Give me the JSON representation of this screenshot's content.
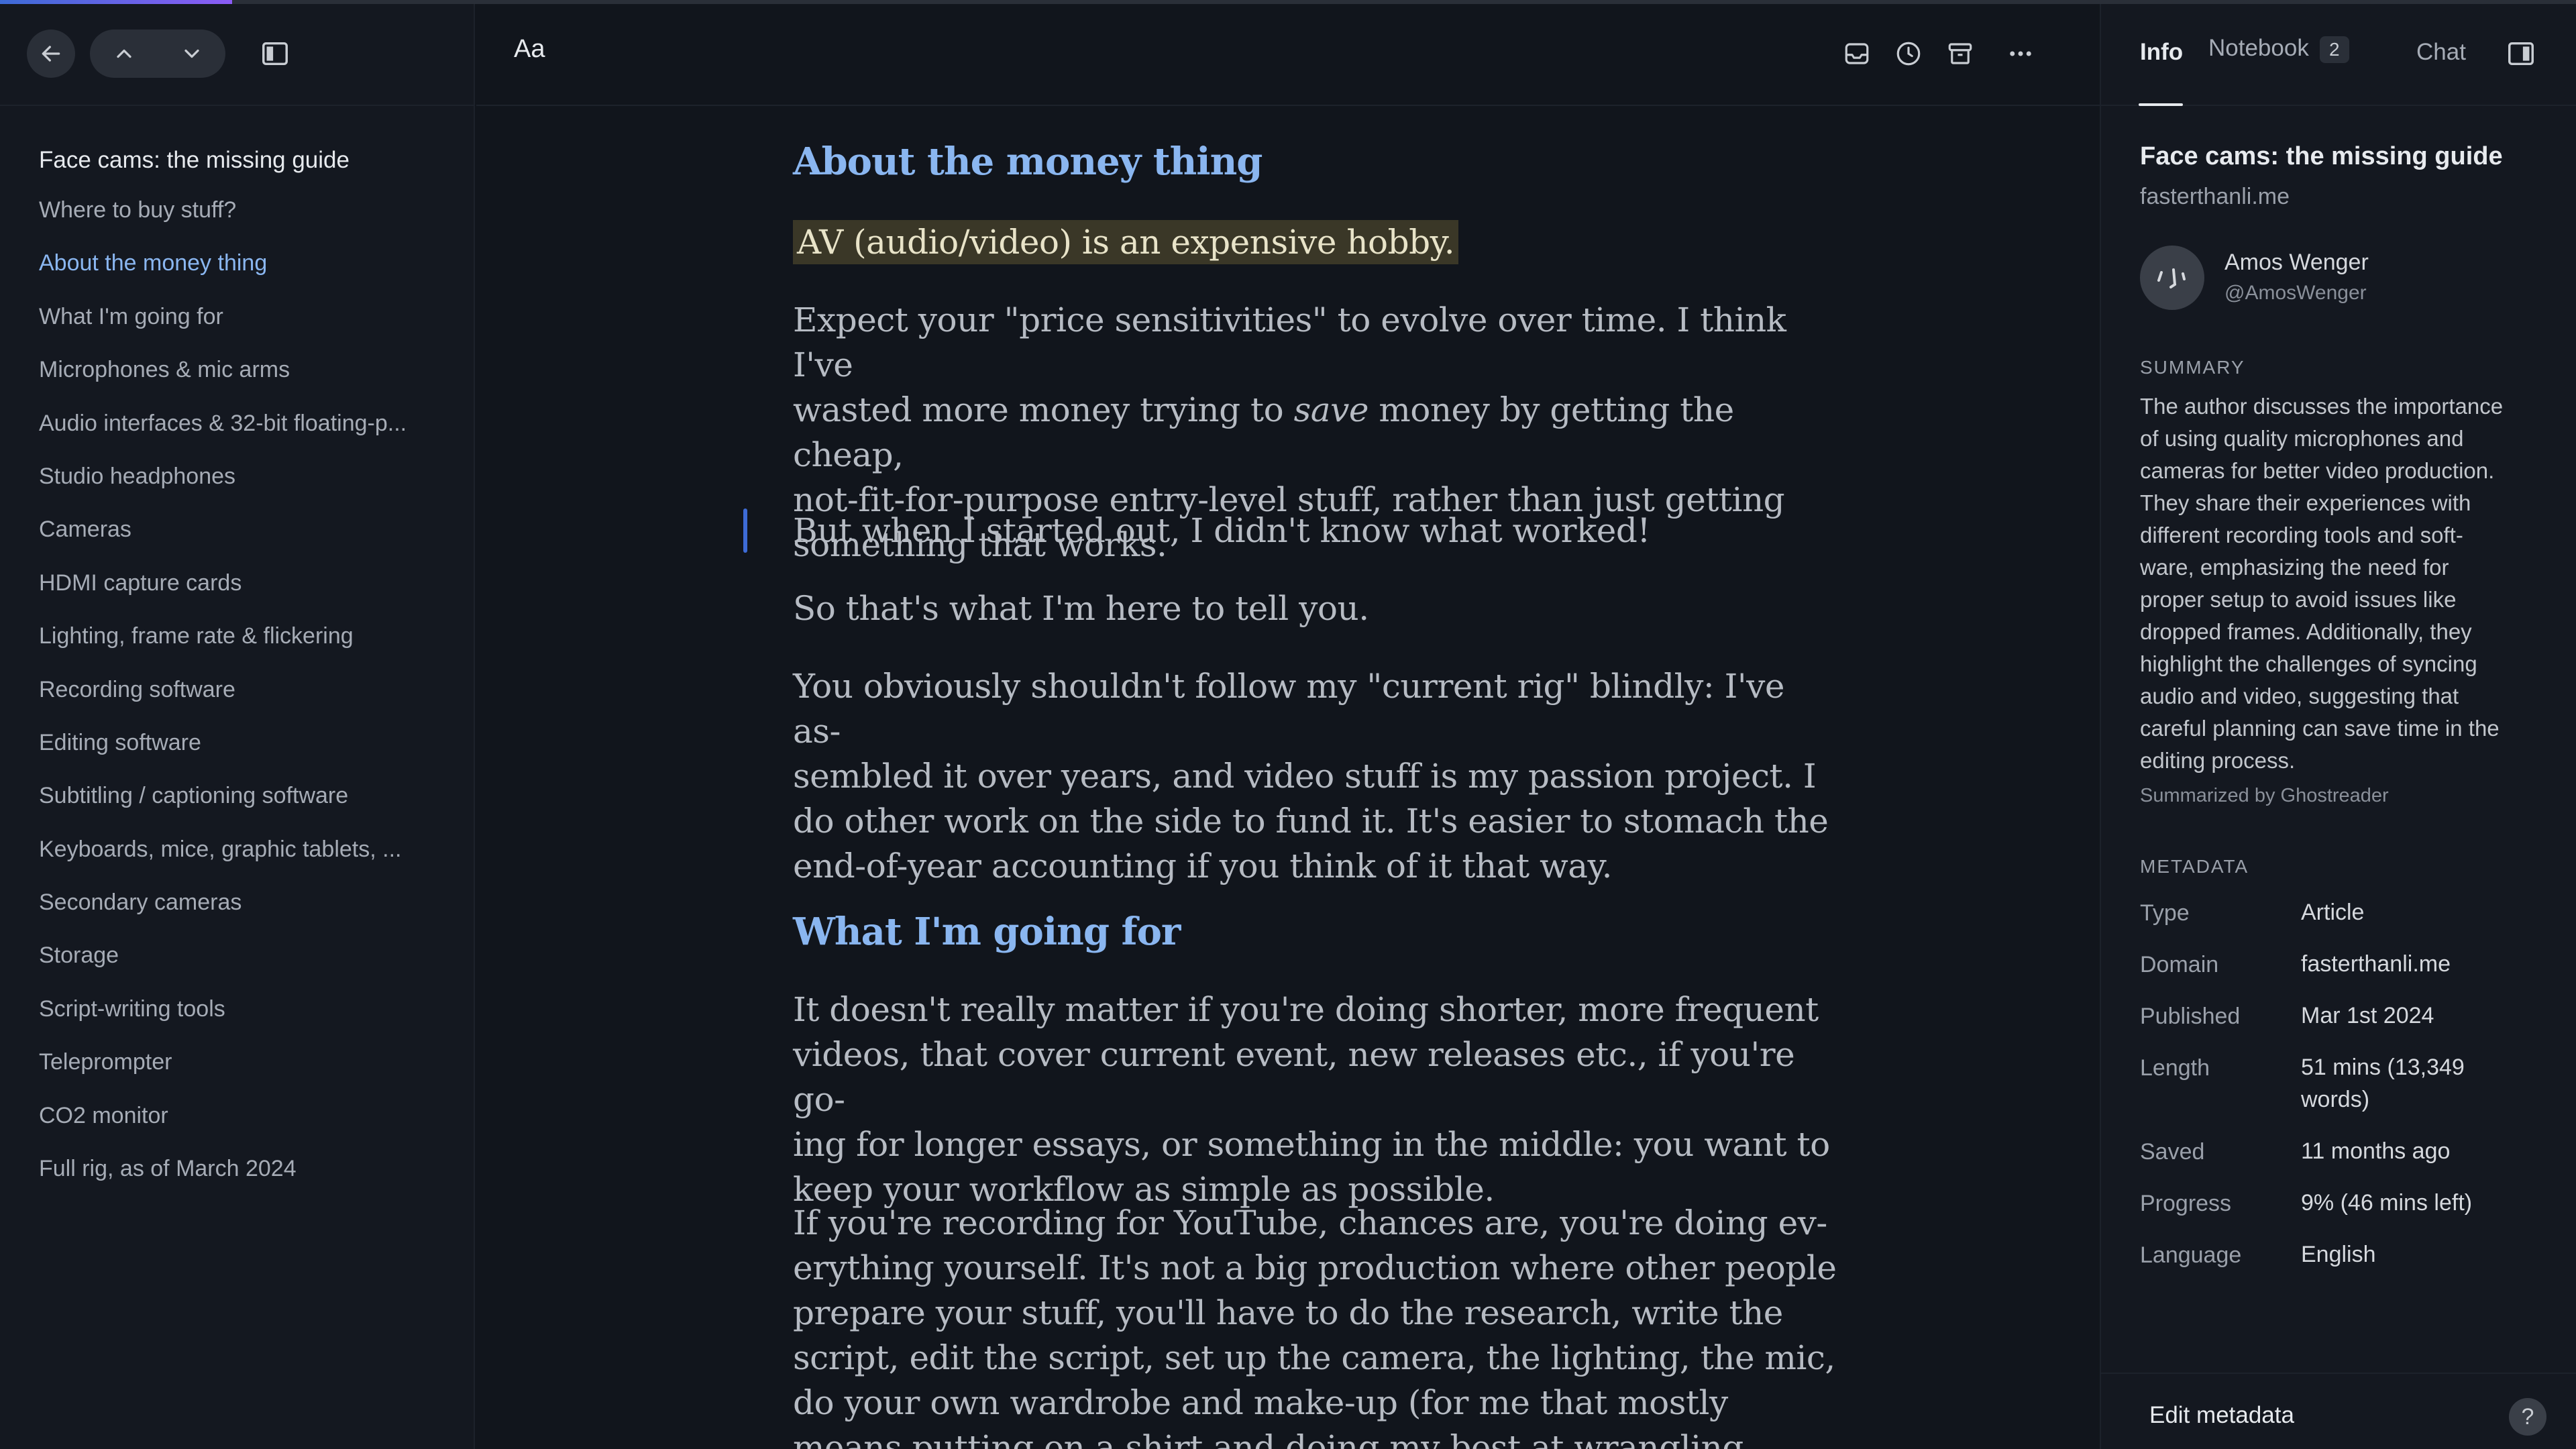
{
  "reading_progress": 0.09,
  "nav": {
    "back_icon": "arrow-left-icon",
    "prev_icon": "chevron-up-icon",
    "next_icon": "chevron-down-icon",
    "sidebar_toggle_icon": "sidebar-toggle-icon"
  },
  "toc": {
    "title": "Face cams: the missing guide",
    "items": [
      "Where to buy stuff?",
      "About the money thing",
      "What I'm going for",
      "Microphones & mic arms",
      "Audio interfaces & 32-bit floating-p...",
      "Studio headphones",
      "Cameras",
      "HDMI capture cards",
      "Lighting, frame rate & flickering",
      "Recording software",
      "Editing software",
      "Subtitling / captioning software",
      "Keyboards, mice, graphic tablets, ...",
      "Secondary cameras",
      "Storage",
      "Script-writing tools",
      "Teleprompter",
      "CO2 monitor",
      "Full rig, as of March 2024"
    ],
    "active_index": 1
  },
  "toolbar": {
    "font_label": "Aa",
    "icons": [
      "inbox-icon",
      "clock-icon",
      "archive-icon",
      "more-icon"
    ]
  },
  "article": {
    "heading1": "About the money thing",
    "highlight": "AV (audio/video) is an expensive hobby.",
    "p1_before": "Expect your \"price sensitivities\" to evolve over time. I think I've",
    "p1_line2_a": "wasted more money trying to ",
    "p1_italic": "save",
    "p1_line2_b": " money by getting the cheap,",
    "p1_line3": "not-fit-for-purpose entry-level stuff, rather than just getting",
    "p1_line4": "something that works.",
    "p2": "But when I started out, I didn't know what worked!",
    "p3": "So that's what I'm here to tell you.",
    "p4_lines": [
      "You obviously shouldn't follow my \"current rig\" blindly: I've as-",
      "sembled it over years, and video stuff is my passion project. I",
      "do other work on the side to fund it. It's easier to stomach the",
      "end-of-year accounting if you think of it that way."
    ],
    "heading2": "What I'm going for",
    "p5_lines": [
      "It doesn't really matter if you're doing shorter, more frequent",
      "videos, that cover current event, new releases etc., if you're go-",
      "ing for longer essays, or something in the middle: you want to",
      "keep your workflow as simple as possible."
    ],
    "p6_lines": [
      "If you're recording for YouTube, chances are, you're doing ev-",
      "erything yourself. It's not a big production where other people",
      "prepare your stuff, you'll have to do the research, write the",
      "script, edit the script, set up the camera, the lighting, the mic,",
      "do your own wardrobe and make-up (for me that mostly",
      "means putting on a shirt and doing my best at wrangling facial"
    ]
  },
  "panel": {
    "tabs": {
      "info": "Info",
      "notebook": "Notebook",
      "notebook_count": "2",
      "chat": "Chat"
    },
    "panel_toggle_icon": "panel-right-icon",
    "title": "Face cams: the missing guide",
    "domain": "fasterthanli.me",
    "author_name": "Amos Wenger",
    "author_handle": "@AmosWenger",
    "summary_label": "SUMMARY",
    "summary_lines": [
      "The author discusses the importance",
      "of using quality microphones and",
      "cameras for better video production.",
      "They share their experiences with",
      "different recording tools and soft-",
      "ware, emphasizing the need for",
      "proper setup to avoid issues like",
      "dropped frames. Additionally, they",
      "highlight the challenges of syncing",
      "audio and video, suggesting that",
      "careful planning can save time in the",
      "editing process."
    ],
    "summarized_by": "Summarized by Ghostreader",
    "metadata_label": "METADATA",
    "metadata": {
      "type_k": "Type",
      "type_v": "Article",
      "domain_k": "Domain",
      "domain_v": "fasterthanli.me",
      "published_k": "Published",
      "published_v": "Mar 1st 2024",
      "length_k": "Length",
      "length_v1": "51 mins (13,349",
      "length_v2": "words)",
      "saved_k": "Saved",
      "saved_v": "11 months ago",
      "progress_k": "Progress",
      "progress_v": "9% (46 mins left)",
      "language_k": "Language",
      "language_v": "English"
    },
    "edit_metadata": "Edit metadata",
    "help": "?"
  }
}
